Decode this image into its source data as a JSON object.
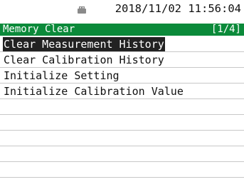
{
  "status_bar": {
    "icon": "usb-icon",
    "datetime": "2018/11/02 11:56:04"
  },
  "title_bar": {
    "title": "Memory Clear",
    "page": "[1/4]",
    "color": "#0b8a3a"
  },
  "menu": {
    "items": [
      {
        "label": "Clear Measurement History",
        "selected": true
      },
      {
        "label": "Clear Calibration History",
        "selected": false
      },
      {
        "label": "Initialize Setting",
        "selected": false
      },
      {
        "label": "Initialize Calibration Value",
        "selected": false
      },
      {
        "label": "",
        "selected": false
      },
      {
        "label": "",
        "selected": false
      },
      {
        "label": "",
        "selected": false
      },
      {
        "label": "",
        "selected": false
      },
      {
        "label": "",
        "selected": false
      }
    ]
  }
}
